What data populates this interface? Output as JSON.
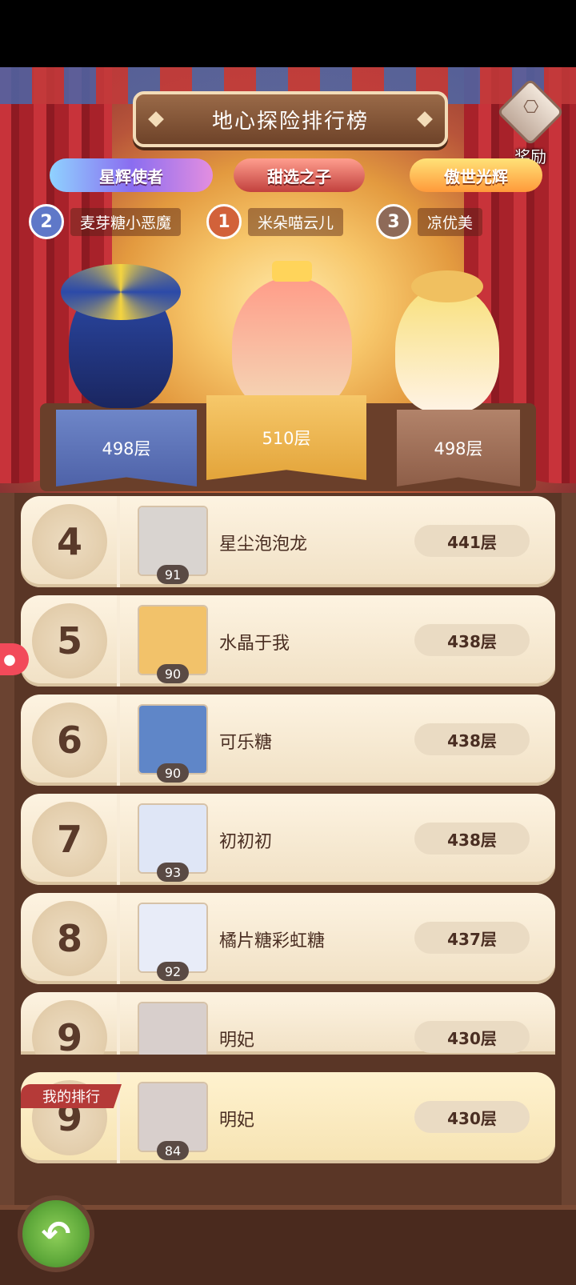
{
  "header": {
    "title": "地心探险排行榜",
    "reward_label": "奖励"
  },
  "podium": {
    "titles": [
      "星辉使者",
      "甜选之子",
      "傲世光辉"
    ],
    "players": [
      {
        "rank": "2",
        "name": "麦芽糖小恶魔",
        "score": "498层"
      },
      {
        "rank": "1",
        "name": "米朵喵云儿",
        "score": "510层"
      },
      {
        "rank": "3",
        "name": "凉优美",
        "score": "498层"
      }
    ]
  },
  "list": [
    {
      "rank": "4",
      "name": "星尘泡泡龙",
      "level": "91",
      "score": "441层",
      "avatar_color": "#d9d4d0"
    },
    {
      "rank": "5",
      "name": "水晶于我",
      "level": "90",
      "score": "438层",
      "avatar_color": "#f2c26a"
    },
    {
      "rank": "6",
      "name": "可乐糖",
      "level": "90",
      "score": "438层",
      "avatar_color": "#5f86c8"
    },
    {
      "rank": "7",
      "name": "初初初",
      "level": "93",
      "score": "438层",
      "avatar_color": "#dfe6f6"
    },
    {
      "rank": "8",
      "name": "橘片糖彩虹糖",
      "level": "92",
      "score": "437层",
      "avatar_color": "#e8ecf8"
    },
    {
      "rank": "9",
      "name": "明妃",
      "level": "",
      "score": "430层",
      "avatar_color": "#d8cfcc"
    }
  ],
  "my_rank": {
    "tag": "我的排行",
    "rank": "9",
    "name": "明妃",
    "level": "84",
    "score": "430层"
  },
  "colors": {
    "accent": "#b53a38",
    "back_button": "#5ea83a",
    "row_bg": "#f6e9d3"
  }
}
